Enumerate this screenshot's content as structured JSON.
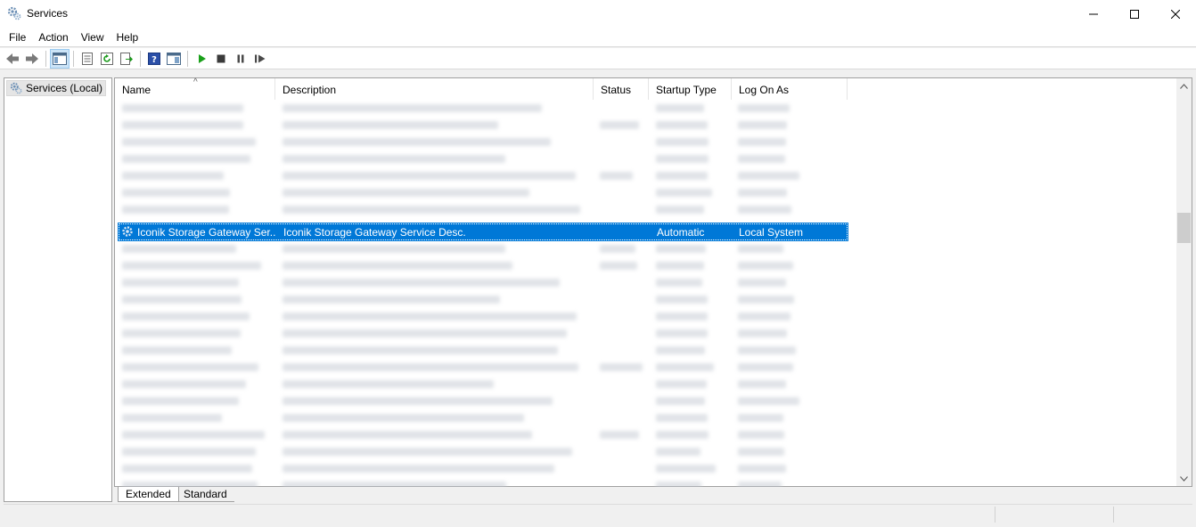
{
  "window": {
    "title": "Services"
  },
  "menu": [
    "File",
    "Action",
    "View",
    "Help"
  ],
  "toolbar": {
    "buttons": [
      "back-icon",
      "forward-icon",
      "show-tree-icon",
      "properties-icon",
      "refresh-icon",
      "export-list-icon",
      "help-icon",
      "console-view-icon",
      "start-service-icon",
      "stop-service-icon",
      "pause-service-icon",
      "resume-service-icon"
    ]
  },
  "tree": {
    "root_label": "Services (Local)"
  },
  "columns": {
    "name": "Name",
    "description": "Description",
    "status": "Status",
    "startup_type": "Startup Type",
    "log_on_as": "Log On As",
    "sorted_by": "Name",
    "sort_direction": "ascending"
  },
  "selected_service": {
    "name": "Iconik Storage Gateway Ser...",
    "description": "Iconik Storage Gateway Service Desc.",
    "status": "",
    "startup_type": "Automatic",
    "log_on_as": "Local System"
  },
  "tabs": {
    "extended": "Extended",
    "standard": "Standard",
    "active": "Extended"
  },
  "colors": {
    "selection": "#0078d7",
    "start_icon": "#1aa01a"
  }
}
